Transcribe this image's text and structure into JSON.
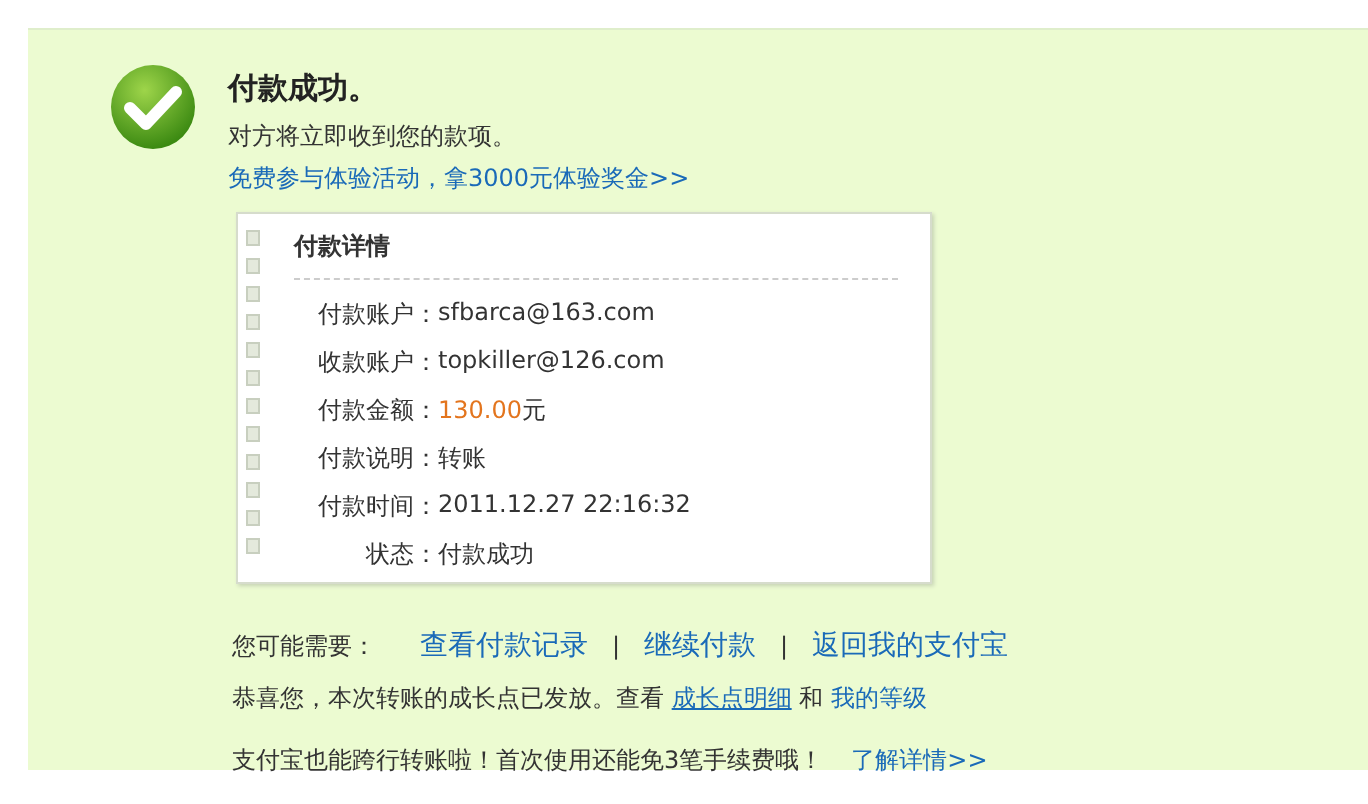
{
  "result": {
    "title": "付款成功。",
    "message": "对方将立即收到您的款项。",
    "promo_link": "免费参与体验活动，拿3000元体验奖金>>"
  },
  "details": {
    "heading": "付款详情",
    "rows": [
      {
        "label": "付款账户：",
        "value": "sfbarca@163.com",
        "kind": "plain"
      },
      {
        "label": "收款账户：",
        "value": "topkiller@126.com",
        "kind": "plain"
      },
      {
        "label": "付款金额：",
        "value": "130.00",
        "unit": "元",
        "kind": "amount"
      },
      {
        "label": "付款说明：",
        "value": "转账",
        "kind": "plain"
      },
      {
        "label": "付款时间：",
        "value": "2011.12.27 22:16:32",
        "kind": "plain"
      },
      {
        "label": "状态：",
        "value": "付款成功",
        "kind": "plain"
      }
    ]
  },
  "next_steps": {
    "label": "您可能需要：",
    "links": [
      "查看付款记录",
      "继续付款",
      "返回我的支付宝"
    ],
    "separators": [
      "|",
      "|"
    ]
  },
  "growth": {
    "text": "恭喜您，本次转账的成长点已发放。查看",
    "link": "成长点明细",
    "joiner": "和",
    "link2": "我的等级"
  },
  "transfer_tip": {
    "text": "支付宝也能跨行转账啦！首次使用还能免3笔手续费哦！",
    "link": "了解详情>>"
  }
}
